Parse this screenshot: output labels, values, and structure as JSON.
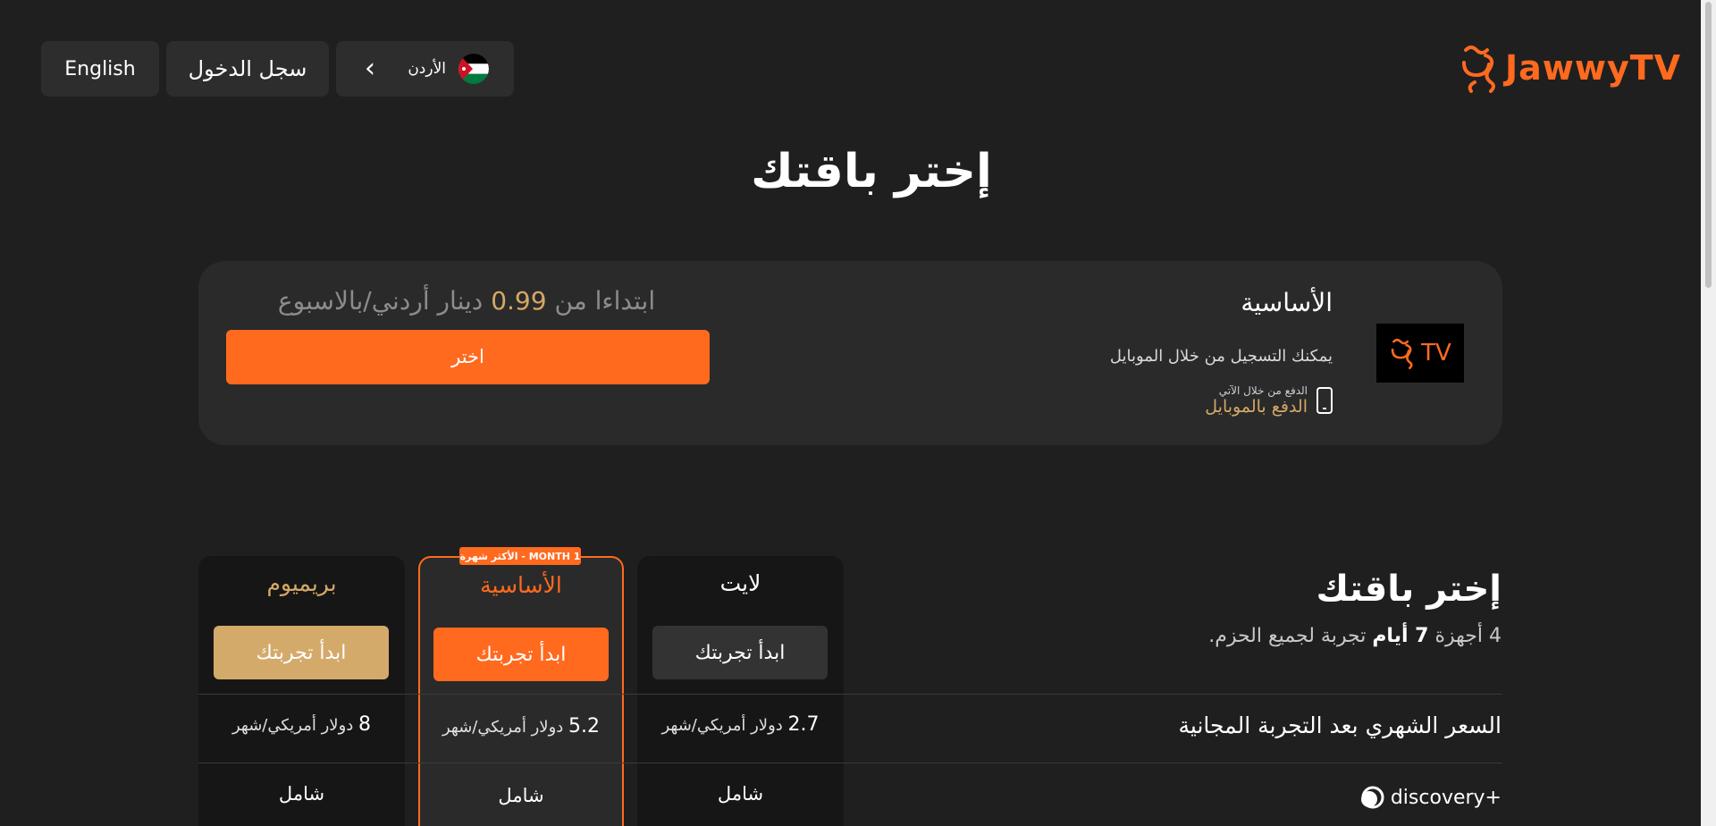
{
  "header": {
    "brand": "JawwyTV",
    "lang_button": "English",
    "login_button": "سجل الدخول",
    "country": "الأردن"
  },
  "page_title": "إختر باقتك",
  "plan_card": {
    "name": "الأساسية",
    "registration_note": "يمكنك التسجيل من خلال الموبايل",
    "pay_small": "الدفع من خلال الآتي",
    "pay_method": "الدفع بالموبايل",
    "tv_logo_text": "TV",
    "price_prefix": "ابتداءا من",
    "price_value": "0.99",
    "price_suffix": "دينار أردني/بالاسبوع",
    "choose_button": "اختر"
  },
  "comparison": {
    "title": "إختر باقتك",
    "subtitle_devices": "4 أجهزة",
    "subtitle_days": "7 أيام",
    "subtitle_rest": "تجربة لجميع الحزم.",
    "badge": "MONTH 1 - الأكثر شهرة",
    "plans": [
      {
        "name": "لايت",
        "trial_button": "ابدأ تجربتك",
        "price": "2.7",
        "price_unit": "دولار أمريكي/شهر",
        "discovery": "شامل"
      },
      {
        "name": "الأساسية",
        "trial_button": "ابدأ تجربتك",
        "price": "5.2",
        "price_unit": "دولار أمريكي/شهر",
        "discovery": "شامل"
      },
      {
        "name": "بريميوم",
        "trial_button": "ابدأ تجربتك",
        "price": "8",
        "price_unit": "دولار أمريكي/شهر",
        "discovery": "شامل"
      }
    ],
    "rows": {
      "monthly_price_label": "السعر الشهري بعد التجربة المجانية",
      "discovery_label": "discovery+"
    }
  },
  "colors": {
    "accent": "#ff6a1f",
    "gold": "#d4a866",
    "background": "#1f1f1f",
    "card": "#2a2a2a"
  },
  "icons": [
    "jawwy-logo-icon",
    "jordan-flag-icon",
    "chevron-left-icon",
    "mobile-phone-icon",
    "discovery-logo-icon"
  ]
}
